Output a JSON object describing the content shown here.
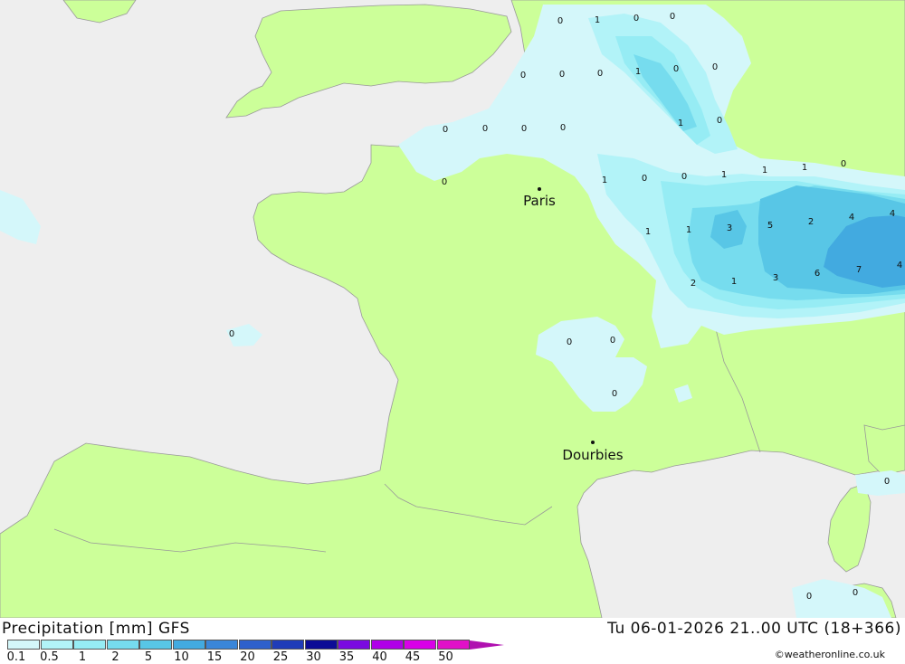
{
  "map": {
    "cities": [
      {
        "name": "Paris"
      },
      {
        "name": "Dourbies"
      }
    ],
    "precip_values": [
      "0",
      "1",
      "0",
      "0",
      "0",
      "0",
      "0",
      "1",
      "0",
      "0",
      "0",
      "1",
      "0",
      "0",
      "0",
      "0",
      "0",
      "0",
      "1",
      "0",
      "0",
      "1",
      "1",
      "1",
      "0",
      "1",
      "1",
      "3",
      "5",
      "2",
      "4",
      "4",
      "2",
      "1",
      "3",
      "6",
      "7",
      "4",
      "0",
      "0",
      "0",
      "0",
      "0",
      "0",
      "0"
    ]
  },
  "footer": {
    "title": "Precipitation [mm] GFS",
    "datetime": "Tu 06-01-2026 21..00 UTC (18+366)",
    "credit": "©weatheronline.co.uk"
  },
  "legend": {
    "ticks": [
      "0.1",
      "0.5",
      "1",
      "2",
      "5",
      "10",
      "15",
      "20",
      "25",
      "30",
      "35",
      "40",
      "45",
      "50"
    ],
    "colors": [
      "#d4f7fa",
      "#b2f3f8",
      "#96ecf4",
      "#76dcee",
      "#58c6e6",
      "#42aae0",
      "#3a86d8",
      "#2e60cc",
      "#1f3cb8",
      "#0c0c96",
      "#7a0ae0",
      "#b000e8",
      "#d800e8",
      "#e010c8"
    ],
    "arrow_color": "#b010b0"
  },
  "colors": {
    "sea": "#eeeeee",
    "land": "#ccff99",
    "border": "#999999"
  }
}
